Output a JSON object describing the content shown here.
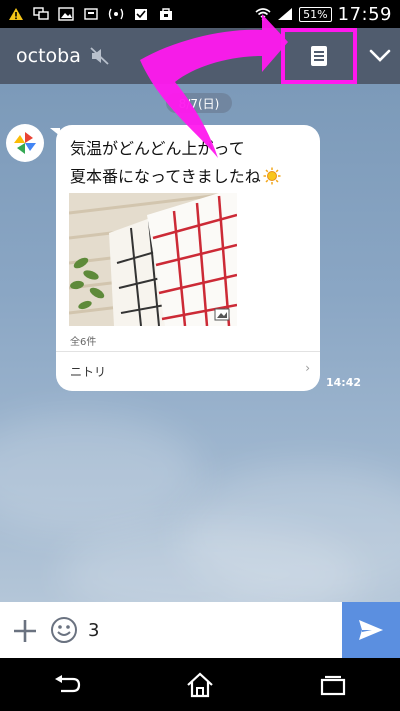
{
  "status_bar": {
    "battery": "51%",
    "time": "17:59"
  },
  "header": {
    "title": "octoba",
    "mute_icon": "mute-icon",
    "notes_icon": "note-icon",
    "menu_icon": "chevron-down-icon"
  },
  "chat": {
    "date": "8/7(日)",
    "message": {
      "line1": "気温がどんどん上がって",
      "line2": "夏本番になってきましたね",
      "photo_count": "全6件",
      "shop": "ニトリ",
      "time": "14:42"
    }
  },
  "input": {
    "value": "3",
    "placeholder": ""
  },
  "colors": {
    "header_bg": "#505c6e",
    "highlight": "#ff18ee",
    "send_bg": "#5b8fe0"
  }
}
